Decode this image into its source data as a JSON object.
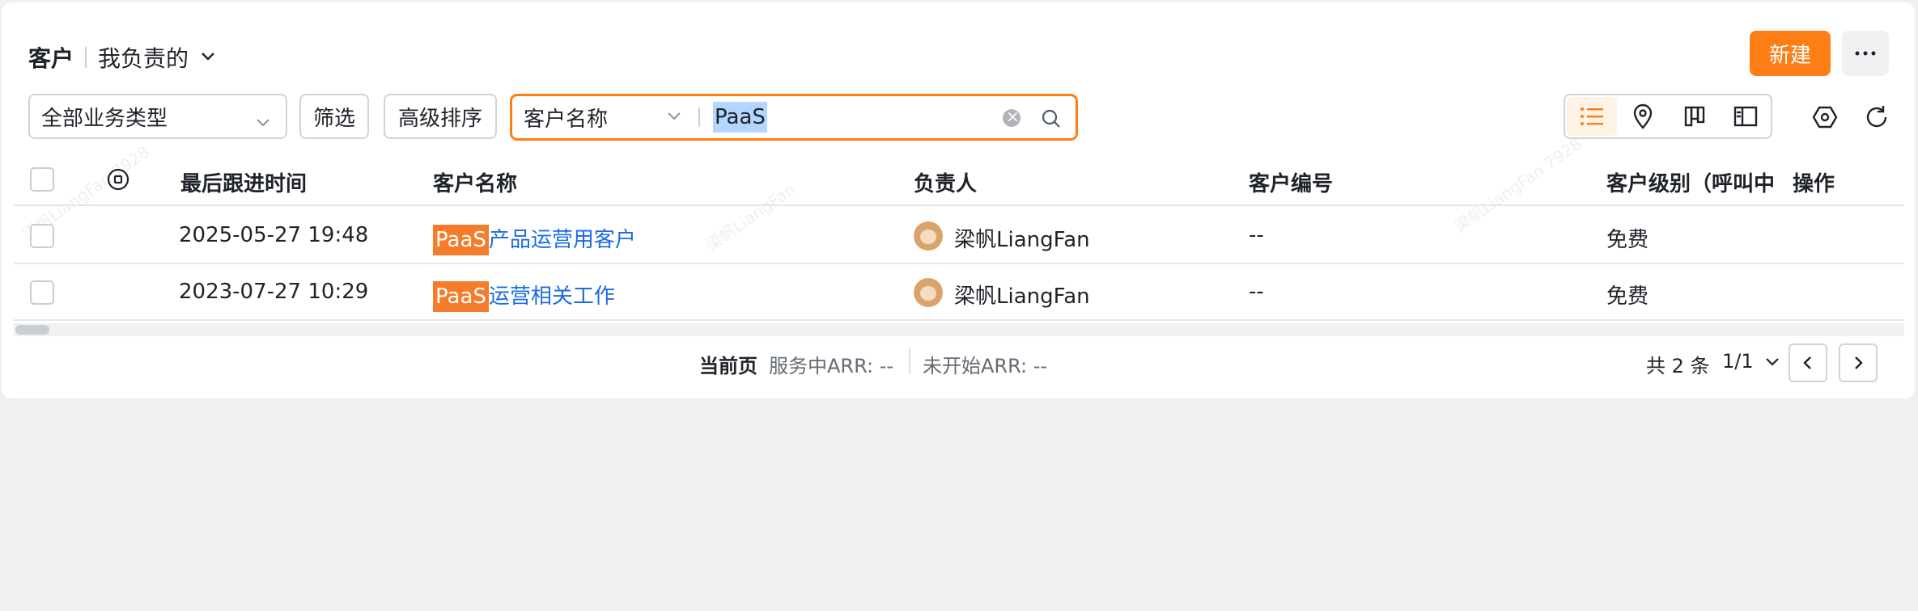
{
  "header": {
    "title": "客户",
    "view_name": "我负责的",
    "new_button": "新建",
    "more_button": "···"
  },
  "toolbar": {
    "business_type": "全部业务类型",
    "filter_button": "筛选",
    "sort_button": "高级排序",
    "search": {
      "field": "客户名称",
      "value": "PaaS"
    },
    "view_modes": [
      "list-view-icon",
      "map-pin-icon",
      "kanban-icon",
      "split-view-icon"
    ],
    "active_view": "list-view-icon"
  },
  "table": {
    "columns": [
      "最后跟进时间",
      "客户名称",
      "负责人",
      "客户编号",
      "客户级别（呼叫中",
      "操作"
    ],
    "rows": [
      {
        "last_follow": "2025-05-27 19:48",
        "name_highlight": "PaaS",
        "name_rest": "产品运营用客户",
        "owner": "梁帆LiangFan",
        "code": "--",
        "level": "免费"
      },
      {
        "last_follow": "2023-07-27 10:29",
        "name_highlight": "PaaS",
        "name_rest": "运营相关工作",
        "owner": "梁帆LiangFan",
        "code": "--",
        "level": "免费"
      }
    ]
  },
  "footer": {
    "current_page_label": "当前页",
    "arr_in_service": "服务中ARR: --",
    "arr_not_started": "未开始ARR: --",
    "total": "共 2 条",
    "page": "1/1"
  },
  "colors": {
    "accent": "#fd7e14",
    "link": "#1a6de0",
    "highlight": "#f57c2a"
  }
}
